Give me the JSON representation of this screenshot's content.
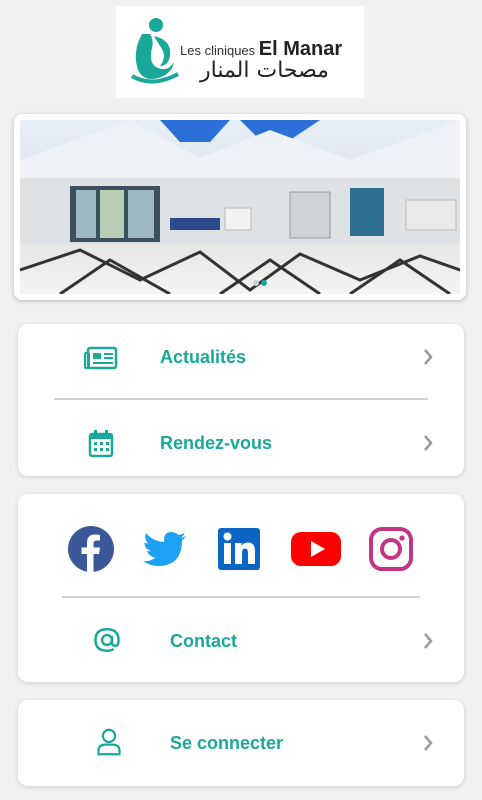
{
  "logo": {
    "line1": "Les cliniques",
    "line1_bold": "El Manar",
    "line2": "مصحات المنار"
  },
  "menu1": {
    "items": [
      {
        "label": "Actualités",
        "icon": "newspaper-icon"
      },
      {
        "label": "Rendez-vous",
        "icon": "calendar-icon"
      }
    ]
  },
  "social": {
    "items": [
      "facebook-icon",
      "twitter-icon",
      "linkedin-icon",
      "youtube-icon",
      "instagram-icon"
    ]
  },
  "contact": {
    "label": "Contact",
    "icon": "at-icon"
  },
  "login": {
    "label": "Se connecter",
    "icon": "user-icon"
  },
  "colors": {
    "accent": "#1aa89a",
    "facebook": "#3b5998",
    "twitter": "#1da1f2",
    "linkedin": "#0a66c2",
    "youtube": "#ff0000",
    "instagram": "#c13584"
  }
}
